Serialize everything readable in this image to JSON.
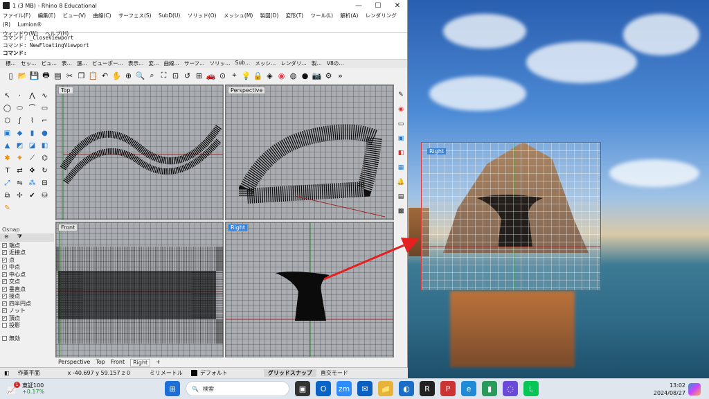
{
  "window": {
    "title": "1 (3 MB) - Rhino 8 Educational",
    "controls": [
      "—",
      "☐",
      "✕"
    ]
  },
  "menu": {
    "items": [
      "ファイル(F)",
      "編集(E)",
      "ビュー(V)",
      "曲線(C)",
      "サーフェス(S)",
      "SubD(U)",
      "ソリッド(O)",
      "メッシュ(M)",
      "製図(D)",
      "変形(T)",
      "ツール(L)",
      "解析(A)",
      "レンダリング(R)",
      "Lumion®",
      "ウィンドウ(W)",
      "ヘルプ(H)"
    ]
  },
  "command": {
    "history": [
      "コマンド: _CloseViewport",
      "コマンド: NewFloatingViewport"
    ],
    "prompt": "コマンド:"
  },
  "toolbar_tabs": [
    "標…",
    "セッ…",
    "ビュ…",
    "表…",
    "選…",
    "ビューポー…",
    "表示…",
    "変…",
    "曲線…",
    "サーフ…",
    "ソリッ…",
    "Sub…",
    "メッシ…",
    "レンダリ…",
    "製…",
    "V8の…"
  ],
  "viewports": {
    "top": "Top",
    "perspective": "Perspective",
    "front": "Front",
    "right": "Right",
    "floating": "Right"
  },
  "osnap": {
    "title": "Osnap",
    "items": [
      {
        "label": "端点",
        "checked": true
      },
      {
        "label": "近接点",
        "checked": true
      },
      {
        "label": "点",
        "checked": true
      },
      {
        "label": "中点",
        "checked": true
      },
      {
        "label": "中心点",
        "checked": true
      },
      {
        "label": "交点",
        "checked": true
      },
      {
        "label": "垂直点",
        "checked": true
      },
      {
        "label": "接点",
        "checked": true
      },
      {
        "label": "四半円点",
        "checked": true
      },
      {
        "label": "ノット",
        "checked": true
      },
      {
        "label": "頂点",
        "checked": true
      },
      {
        "label": "投影",
        "checked": false
      },
      {
        "label": "無効",
        "checked": false
      }
    ]
  },
  "view_tabs": [
    "Perspective",
    "Top",
    "Front",
    "Right",
    "+"
  ],
  "status": {
    "cplane": "作業平面",
    "coords": "x -40.697  y 59.157  z 0",
    "units": "ミリメートル",
    "layer": "デフォルト",
    "grid_snap": "グリッドスナップ",
    "ortho": "直交モード"
  },
  "taskbar": {
    "weather_temp": "東証100",
    "weather_change": "+0.17%",
    "notification_count": "1",
    "search_placeholder": "検索",
    "time": "13:02",
    "date": "2024/08/27"
  }
}
